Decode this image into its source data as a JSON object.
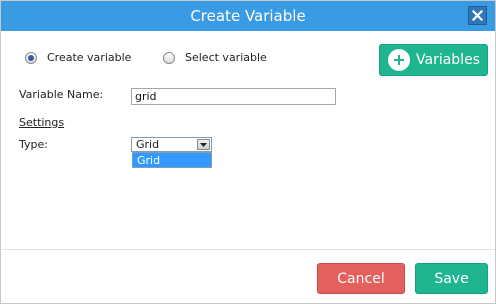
{
  "dialog": {
    "title": "Create Variable",
    "close_icon": "close-icon",
    "colors": {
      "titlebar": "#3a9be5",
      "accent": "#1fb591",
      "cancel": "#e3605c"
    }
  },
  "mode": {
    "create_label": "Create variable",
    "select_label": "Select variable",
    "selected": "create"
  },
  "variables_button": {
    "label": "Variables",
    "icon": "plus-icon"
  },
  "form": {
    "variable_name_label": "Variable Name:",
    "variable_name_value": "grid",
    "settings_label": "Settings",
    "type_label": "Type:",
    "type_selected": "Grid",
    "type_options": [
      "Grid"
    ]
  },
  "footer": {
    "cancel_label": "Cancel",
    "save_label": "Save"
  }
}
